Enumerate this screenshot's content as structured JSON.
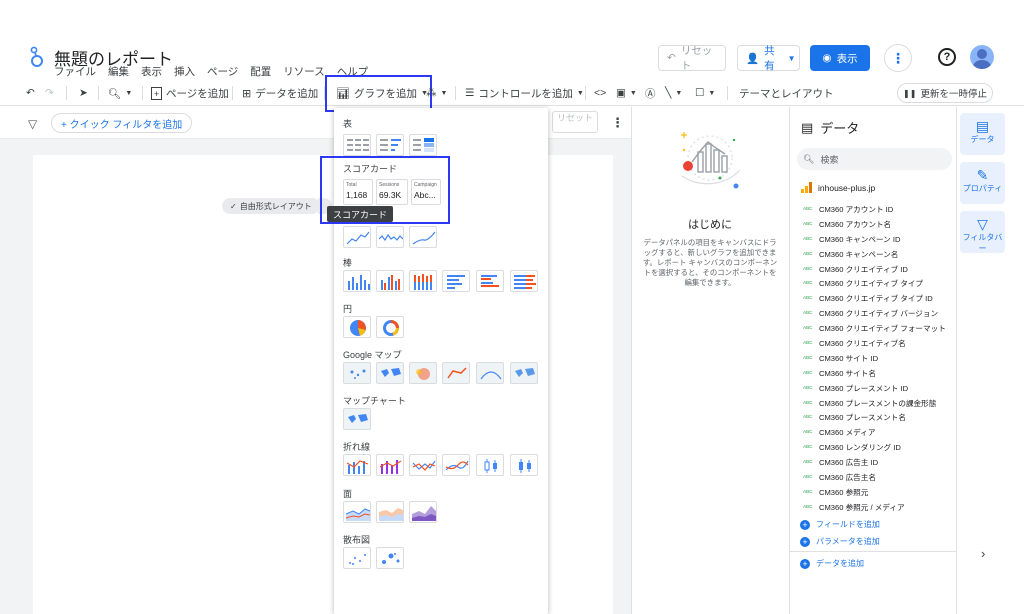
{
  "header": {
    "title": "無題のレポート",
    "menu": [
      "ファイル",
      "編集",
      "表示",
      "挿入",
      "ページ",
      "配置",
      "リソース",
      "ヘルプ"
    ],
    "reset_label": "リセット",
    "share_label": "共有",
    "view_label": "表示",
    "help_label": "?"
  },
  "toolbar": {
    "add_page": "ページを追加",
    "add_data": "データを追加",
    "add_chart": "グラフを追加",
    "add_control": "コントロールを追加",
    "theme_layout": "テーマとレイアウト",
    "pause_update": "更新を一時停止"
  },
  "subbar": {
    "quick_filter": "+ クイック フィルタを追加",
    "reset": "リセット"
  },
  "canvas": {
    "freeform_layout": "自由形式レイアウト"
  },
  "chart_menu": {
    "sections": {
      "table": "表",
      "scorecard": "スコアカード",
      "bar": "棒",
      "pie": "円",
      "google_maps": "Google マップ",
      "map_chart": "マップチャート",
      "line": "折れ線",
      "area": "面",
      "scatter": "散布図"
    },
    "scorecards": [
      {
        "label": "Total",
        "value": "1,168"
      },
      {
        "label": "Sessions",
        "value": "69.3K"
      },
      {
        "label": "Campaign",
        "value": "Abc..."
      }
    ],
    "tooltip": "スコアカード"
  },
  "empty_panel": {
    "heading": "はじめに",
    "text": "データパネルの項目をキャンバスにドラッグすると、新しいグラフを追加できます。レポート キャンバスのコンポーネントを選択すると、そのコンポーネントを編集できます。"
  },
  "data_panel": {
    "title": "データ",
    "search_placeholder": "検索",
    "source": "inhouse-plus.jp",
    "type_badge": "ABC",
    "fields": [
      "CM360 アカウント ID",
      "CM360 アカウント名",
      "CM360 キャンペーン ID",
      "CM360 キャンペーン名",
      "CM360 クリエイティブ ID",
      "CM360 クリエイティブ タイプ",
      "CM360 クリエイティブ タイプ ID",
      "CM360 クリエイティブ バージョン",
      "CM360 クリエイティブ フォーマット",
      "CM360 クリエイティブ名",
      "CM360 サイト ID",
      "CM360 サイト名",
      "CM360 プレースメント ID",
      "CM360 プレースメントの課金形態",
      "CM360 プレースメント名",
      "CM360 メディア",
      "CM360 レンダリング ID",
      "CM360 広告主 ID",
      "CM360 広告主名",
      "CM360 参照元",
      "CM360 参照元 / メディア"
    ],
    "add_field": "フィールドを追加",
    "add_parameter": "パラメータを追加",
    "add_data": "データを追加"
  },
  "rail": {
    "data": "データ",
    "properties": "プロパティ",
    "filter": "フィルタバー"
  },
  "colors": {
    "accent": "#1a73e8",
    "highlight": "#2b39f5"
  }
}
